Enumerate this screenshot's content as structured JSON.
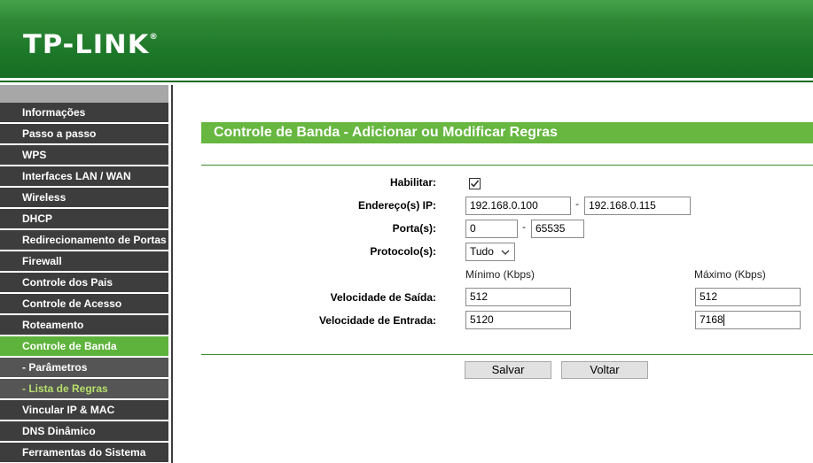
{
  "header": {
    "logo": "TP-LINK",
    "logo_mark": "®"
  },
  "sidebar": {
    "items": [
      {
        "label": "Informações",
        "state": "normal"
      },
      {
        "label": "Passo a passo",
        "state": "normal"
      },
      {
        "label": "WPS",
        "state": "normal"
      },
      {
        "label": "Interfaces LAN / WAN",
        "state": "normal"
      },
      {
        "label": "Wireless",
        "state": "normal"
      },
      {
        "label": "DHCP",
        "state": "normal"
      },
      {
        "label": "Redirecionamento de Portas",
        "state": "normal"
      },
      {
        "label": "Firewall",
        "state": "normal"
      },
      {
        "label": "Controle dos Pais",
        "state": "normal"
      },
      {
        "label": "Controle de Acesso",
        "state": "normal"
      },
      {
        "label": "Roteamento",
        "state": "normal"
      },
      {
        "label": "Controle de Banda",
        "state": "active"
      },
      {
        "label": "- Parâmetros",
        "state": "sub"
      },
      {
        "label": "- Lista de Regras",
        "state": "subactive"
      },
      {
        "label": "Vincular IP & MAC",
        "state": "normal"
      },
      {
        "label": "DNS Dinâmico",
        "state": "normal"
      },
      {
        "label": "Ferramentas do Sistema",
        "state": "normal"
      }
    ]
  },
  "main": {
    "title": "Controle de Banda - Adicionar ou Modificar Regras",
    "form": {
      "enable_label": "Habilitar:",
      "enable_checked": true,
      "ip_label": "Endereço(s) IP:",
      "ip_start": "192.168.0.100",
      "ip_end": "192.168.0.115",
      "port_label": "Porta(s):",
      "port_start": "0",
      "port_end": "65535",
      "range_sep": "-",
      "protocol_label": "Protocolo(s):",
      "protocol_value": "Tudo",
      "min_header": "Mínimo (Kbps)",
      "max_header": "Máximo (Kbps)",
      "egress_label": "Velocidade de Saída:",
      "egress_min": "512",
      "egress_max": "512",
      "ingress_label": "Velocidade de Entrada:",
      "ingress_min": "5120",
      "ingress_max": "7168"
    },
    "buttons": {
      "save": "Salvar",
      "back": "Voltar"
    }
  },
  "colors": {
    "header_green": "#1f7a2b",
    "title_green": "#67b740",
    "menu_dark": "#3d3d3d",
    "menu_active": "#5db33b",
    "submenu_active_text": "#b6df6a"
  }
}
